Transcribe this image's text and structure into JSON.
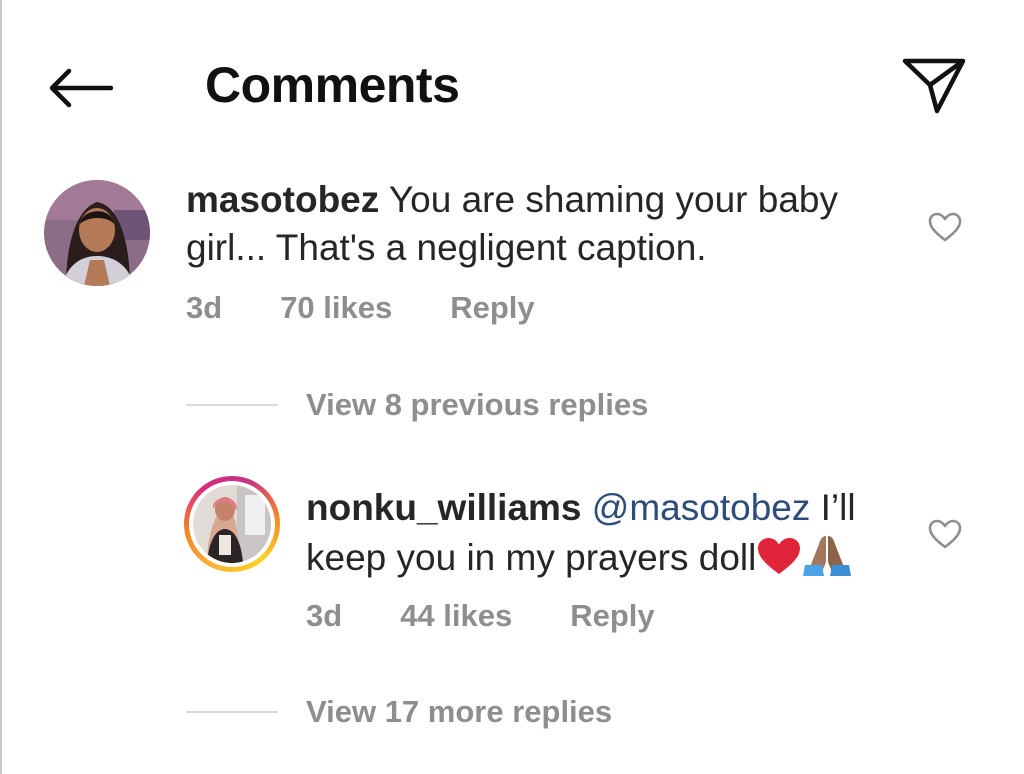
{
  "header": {
    "title": "Comments",
    "back_icon": "arrow-left-icon",
    "share_icon": "paper-plane-icon"
  },
  "comments": [
    {
      "username": "masotobez",
      "text": "You are shaming your baby girl... That's a negligent caption.",
      "time": "3d",
      "likes": "70 likes",
      "reply_label": "Reply",
      "like_icon": "heart-outline-icon",
      "replies_toggle": "View 8 previous replies"
    },
    {
      "username": "nonku_williams",
      "mention": "@masotobez",
      "text": "I’ll keep you in my prayers doll",
      "emojis": [
        "red-heart-emoji",
        "folded-hands-emoji"
      ],
      "time": "3d",
      "likes": "44 likes",
      "reply_label": "Reply",
      "like_icon": "heart-outline-icon",
      "has_story_ring": true,
      "replies_toggle": "View 17 more replies"
    }
  ],
  "colors": {
    "text": "#262626",
    "secondary": "#8e8e8e",
    "mention": "#2d4c7a",
    "story_ring": [
      "#f9b53a",
      "#f58529",
      "#dd2a7b",
      "#c13584"
    ],
    "heart_emoji": "#e0243a"
  }
}
